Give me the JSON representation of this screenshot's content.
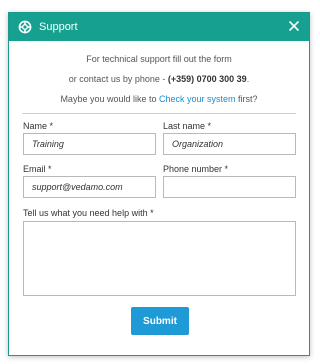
{
  "dialog": {
    "title": "Support",
    "close_symbol": "×",
    "icons": {
      "title": "lifebuoy-icon",
      "close": "close-icon"
    },
    "colors": {
      "header": "#16a08f",
      "link": "#1a8fcf",
      "button": "#1e9ad6"
    }
  },
  "intro": {
    "line1": "For technical support fill out the form",
    "line2_prefix": "or contact us by phone - ",
    "phone": "(+359) 0700 300 39",
    "line2_suffix": ".",
    "line3_prefix": "Maybe you would like to ",
    "link_text": "Check your system",
    "line3_suffix": " first?"
  },
  "form": {
    "name_label": "Name *",
    "name_value": "Training",
    "last_name_label": "Last name *",
    "last_name_value": "Organization",
    "email_label": "Email *",
    "email_value": "support@vedamo.com",
    "phone_label": "Phone number *",
    "phone_value": "",
    "message_label": "Tell us what you need help with *",
    "message_value": "",
    "submit_label": "Submit"
  }
}
